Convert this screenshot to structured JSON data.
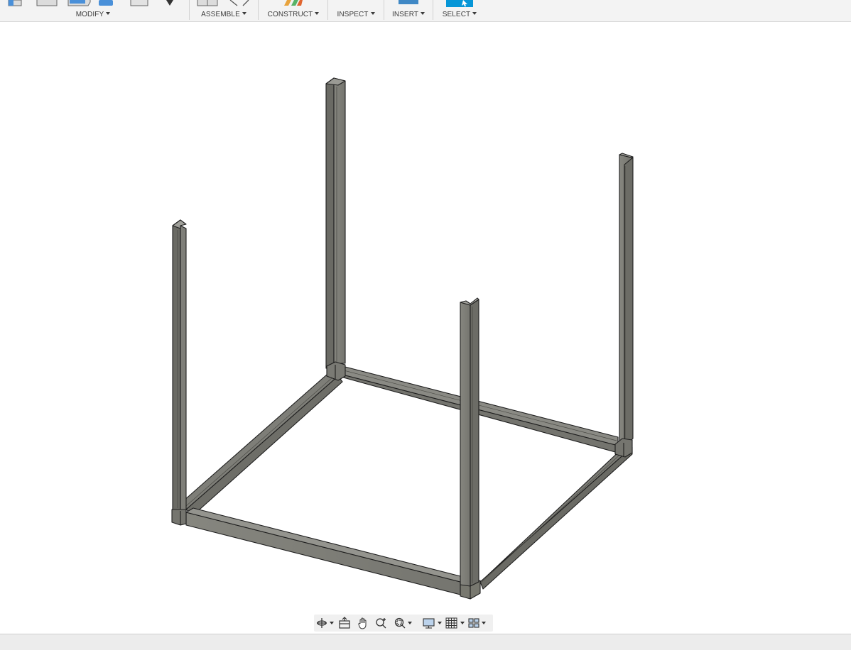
{
  "toolbar": {
    "groups": [
      {
        "label": "MODIFY"
      },
      {
        "label": "ASSEMBLE"
      },
      {
        "label": "CONSTRUCT"
      },
      {
        "label": "INSPECT"
      },
      {
        "label": "INSERT"
      },
      {
        "label": "SELECT"
      }
    ]
  },
  "viewport": {
    "model": "steel frame with channel posts"
  },
  "navbar": {
    "buttons": [
      {
        "icon": "orbit-icon",
        "dropdown": true
      },
      {
        "icon": "look-at-icon",
        "dropdown": false
      },
      {
        "icon": "pan-icon",
        "dropdown": false
      },
      {
        "icon": "zoom-icon",
        "dropdown": false
      },
      {
        "icon": "zoom-window-icon",
        "dropdown": true
      },
      {
        "icon": "display-settings-icon",
        "dropdown": true
      },
      {
        "icon": "grid-icon",
        "dropdown": true
      },
      {
        "icon": "viewports-icon",
        "dropdown": true
      }
    ]
  },
  "colors": {
    "accent": "#0696d7",
    "steel_front": "#7b7b75",
    "steel_side": "#6c6c66",
    "steel_top": "#9a9a94",
    "edge": "#1e1e1e"
  }
}
